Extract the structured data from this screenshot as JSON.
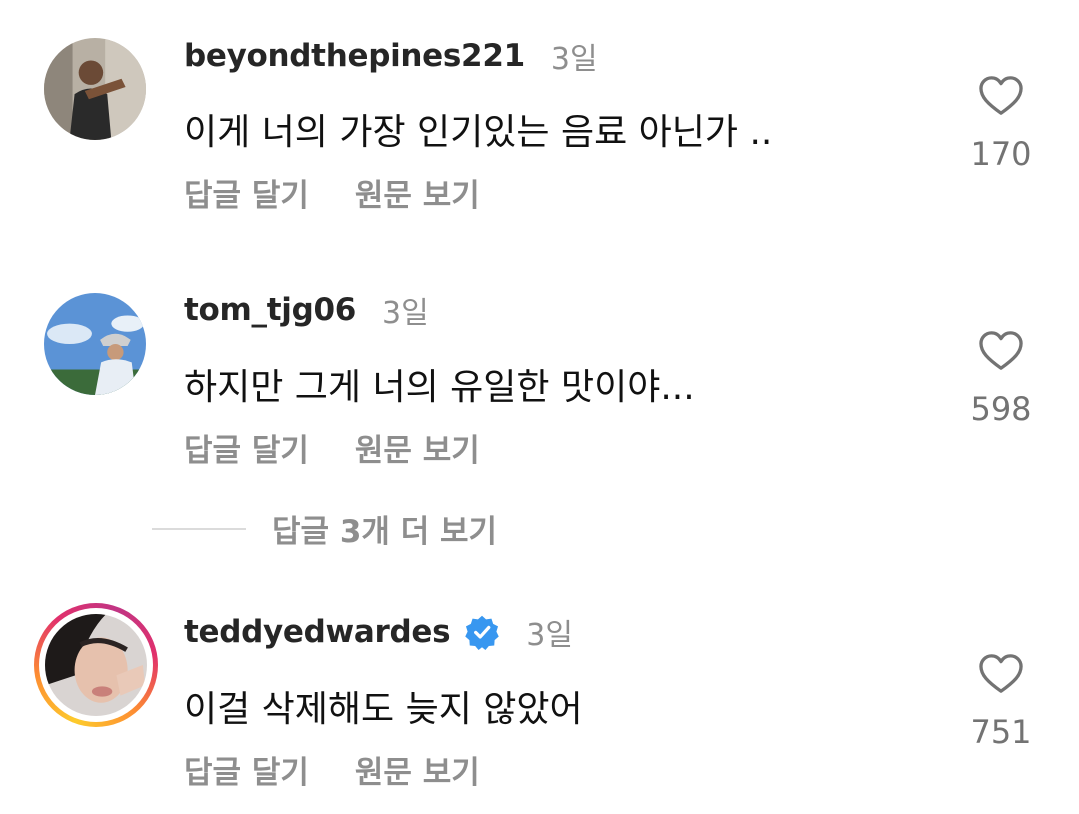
{
  "comments": [
    {
      "username": "beyondthepines221",
      "time": "3일",
      "text": "이게 너의 가장 인기있는 음료 아닌가 ..",
      "reply_label": "답글 달기",
      "translate_label": "원문 보기",
      "like_count": "170",
      "icon": "heart-outline-icon"
    },
    {
      "username": "tom_tjg06",
      "time": "3일",
      "text": "하지만 그게 너의 유일한 맛이야...",
      "reply_label": "답글 달기",
      "translate_label": "원문 보기",
      "like_count": "598",
      "icon": "heart-outline-icon"
    },
    {
      "username": "teddyedwardes",
      "verified": true,
      "time": "3일",
      "text": "이걸 삭제해도 늦지 않았어",
      "reply_label": "답글 달기",
      "translate_label": "원문 보기",
      "like_count": "751",
      "icon": "heart-outline-icon"
    }
  ],
  "more_replies_label": "답글 3개 더 보기",
  "colors": {
    "secondary_text": "#8e8e8e",
    "verified_blue": "#3897f0",
    "story_ring": [
      "#fdcb2c",
      "#fd8d32",
      "#e1306c",
      "#c13584"
    ]
  }
}
